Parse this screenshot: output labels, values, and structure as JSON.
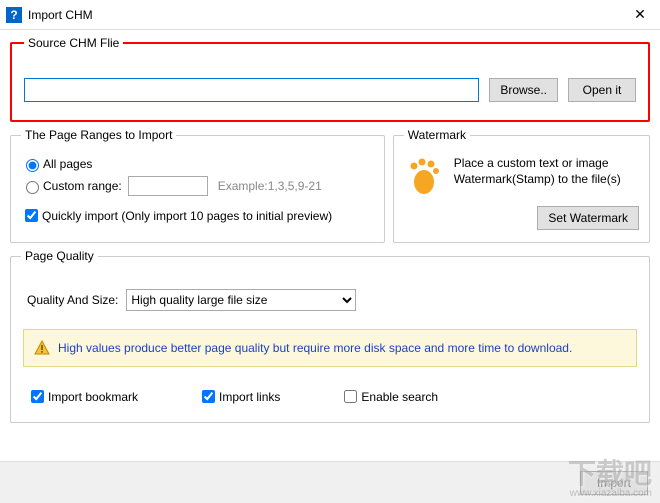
{
  "window": {
    "title": "Import CHM",
    "icon_glyph": "?"
  },
  "source": {
    "legend": "Source CHM Flie",
    "path": "",
    "browse": "Browse..",
    "open": "Open it"
  },
  "ranges": {
    "legend": "The Page Ranges to Import",
    "all": "All pages",
    "custom": "Custom range:",
    "custom_value": "",
    "example": "Example:1,3,5,9-21",
    "quick": "Quickly import (Only import 10 pages to  initial  preview)"
  },
  "watermark": {
    "legend": "Watermark",
    "text": "Place a custom text or image Watermark(Stamp) to the file(s)",
    "button": "Set Watermark"
  },
  "quality": {
    "legend": "Page Quality",
    "label": "Quality And Size:",
    "selected": "High quality large file size",
    "info": "High values produce better page quality but require more disk space and more time to download."
  },
  "options": {
    "bookmark": "Import bookmark",
    "links": "Import links",
    "search": "Enable search"
  },
  "footer": {
    "import": "Import"
  },
  "overlay": {
    "brand": "下载吧",
    "url": "www.xiazaiba.com"
  }
}
